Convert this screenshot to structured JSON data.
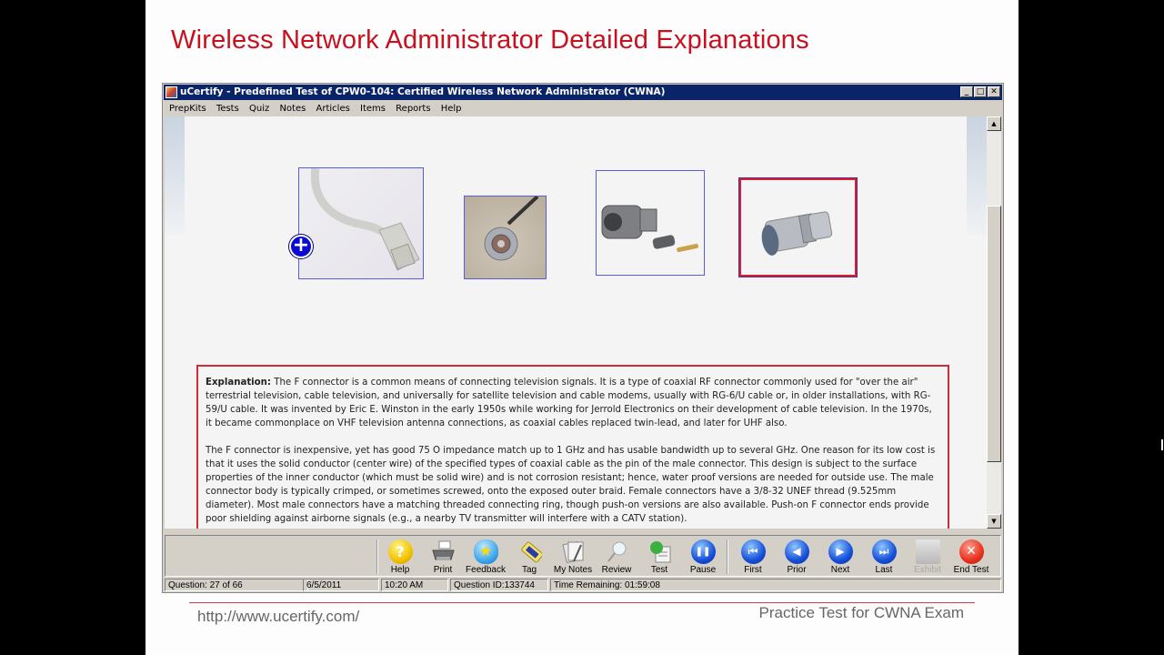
{
  "slide": {
    "title": "Wireless Network Administrator Detailed Explanations",
    "footer_url": "http://www.ucertify.com/",
    "footer_right": "Practice Test for CWNA Exam"
  },
  "window": {
    "title": "uCertify - Predefined Test of  CPW0-104: Certified Wireless Network Administrator (CWNA)",
    "controls": {
      "minimize": "_",
      "maximize": "□",
      "close": "✕"
    },
    "menu": [
      "PrepKits",
      "Tests",
      "Quiz",
      "Notes",
      "Articles",
      "Items",
      "Reports",
      "Help"
    ]
  },
  "images": [
    {
      "name": "rj45-connector",
      "selected": false
    },
    {
      "name": "n-type-connector",
      "selected": false
    },
    {
      "name": "n-type-crimp-connector-kit",
      "selected": false
    },
    {
      "name": "f-connector-barrel",
      "selected": true
    }
  ],
  "zoom_icon": "+",
  "explanation": {
    "label": "Explanation:",
    "paragraph1": " The F connector is a common means of connecting television signals. It is a type of coaxial RF connector commonly used for \"over the air\" terrestrial television, cable television, and universally for satellite television and cable modems, usually with RG-6/U cable or, in older installations, with RG-59/U cable. It was invented by Eric E. Winston in the early 1950s while working for Jerrold Electronics on their development of cable television. In the 1970s, it became commonplace on VHF television antenna connections, as coaxial cables replaced twin-lead, and later for UHF also.",
    "paragraph2": "The F connector is inexpensive, yet has good 75 O impedance match up to 1 GHz and has usable bandwidth up to several GHz. One reason for its low cost is that it uses the solid conductor (center wire) of the specified types of coaxial cable as the pin of the male connector. This design is subject to the surface properties of the inner conductor (which must be solid wire) and is not corrosion resistant; hence, water proof versions are needed for outside use. The male connector body is typically crimped, or sometimes screwed, onto the exposed outer braid. Female connectors have a 3/8-32 UNEF thread (9.525mm diameter). Most male connectors have a matching threaded connecting ring, though push-on versions are also available. Push-on F connector ends provide poor shielding against airborne signals (e.g., a nearby TV transmitter will interfere with a CATV station)."
  },
  "toolbar": {
    "buttons": [
      {
        "label": "Help",
        "icon": "help-icon",
        "enabled": true
      },
      {
        "label": "Print",
        "icon": "printer-icon",
        "enabled": true
      },
      {
        "label": "Feedback",
        "icon": "feedback-icon",
        "enabled": true
      },
      {
        "label": "Tag",
        "icon": "tag-icon",
        "enabled": true
      },
      {
        "label": "My Notes",
        "icon": "notes-icon",
        "enabled": true
      },
      {
        "label": "Review",
        "icon": "magnifier-icon",
        "enabled": true
      },
      {
        "label": "Test",
        "icon": "test-icon",
        "enabled": true
      },
      {
        "label": "Pause",
        "icon": "pause-icon",
        "enabled": true
      },
      {
        "label": "First",
        "icon": "first-icon",
        "enabled": true
      },
      {
        "label": "Prior",
        "icon": "prior-icon",
        "enabled": true
      },
      {
        "label": "Next",
        "icon": "next-icon",
        "enabled": true
      },
      {
        "label": "Last",
        "icon": "last-icon",
        "enabled": true
      },
      {
        "label": "Exhibit",
        "icon": "exhibit-icon",
        "enabled": false
      },
      {
        "label": "End Test",
        "icon": "end-test-icon",
        "enabled": true
      }
    ],
    "glyphs": {
      "help": "?",
      "pause": "❚❚",
      "first": "⏮",
      "prior": "◀",
      "next": "▶",
      "last": "⏭",
      "end": "✕"
    }
  },
  "status": {
    "question": "Question: 27 of 66",
    "date": "6/5/2011",
    "time": "10:20 AM",
    "question_id": "Question ID:133744",
    "time_remaining": "Time Remaining: 01:59:08"
  },
  "scrollbar": {
    "up": "▲",
    "down": "▼",
    "position_fraction": 0.2
  },
  "colors": {
    "title_red": "#c8101e",
    "titlebar_blue": "#0a246a",
    "selected_border": "#d0203a",
    "image_border": "#5a5ae0"
  }
}
